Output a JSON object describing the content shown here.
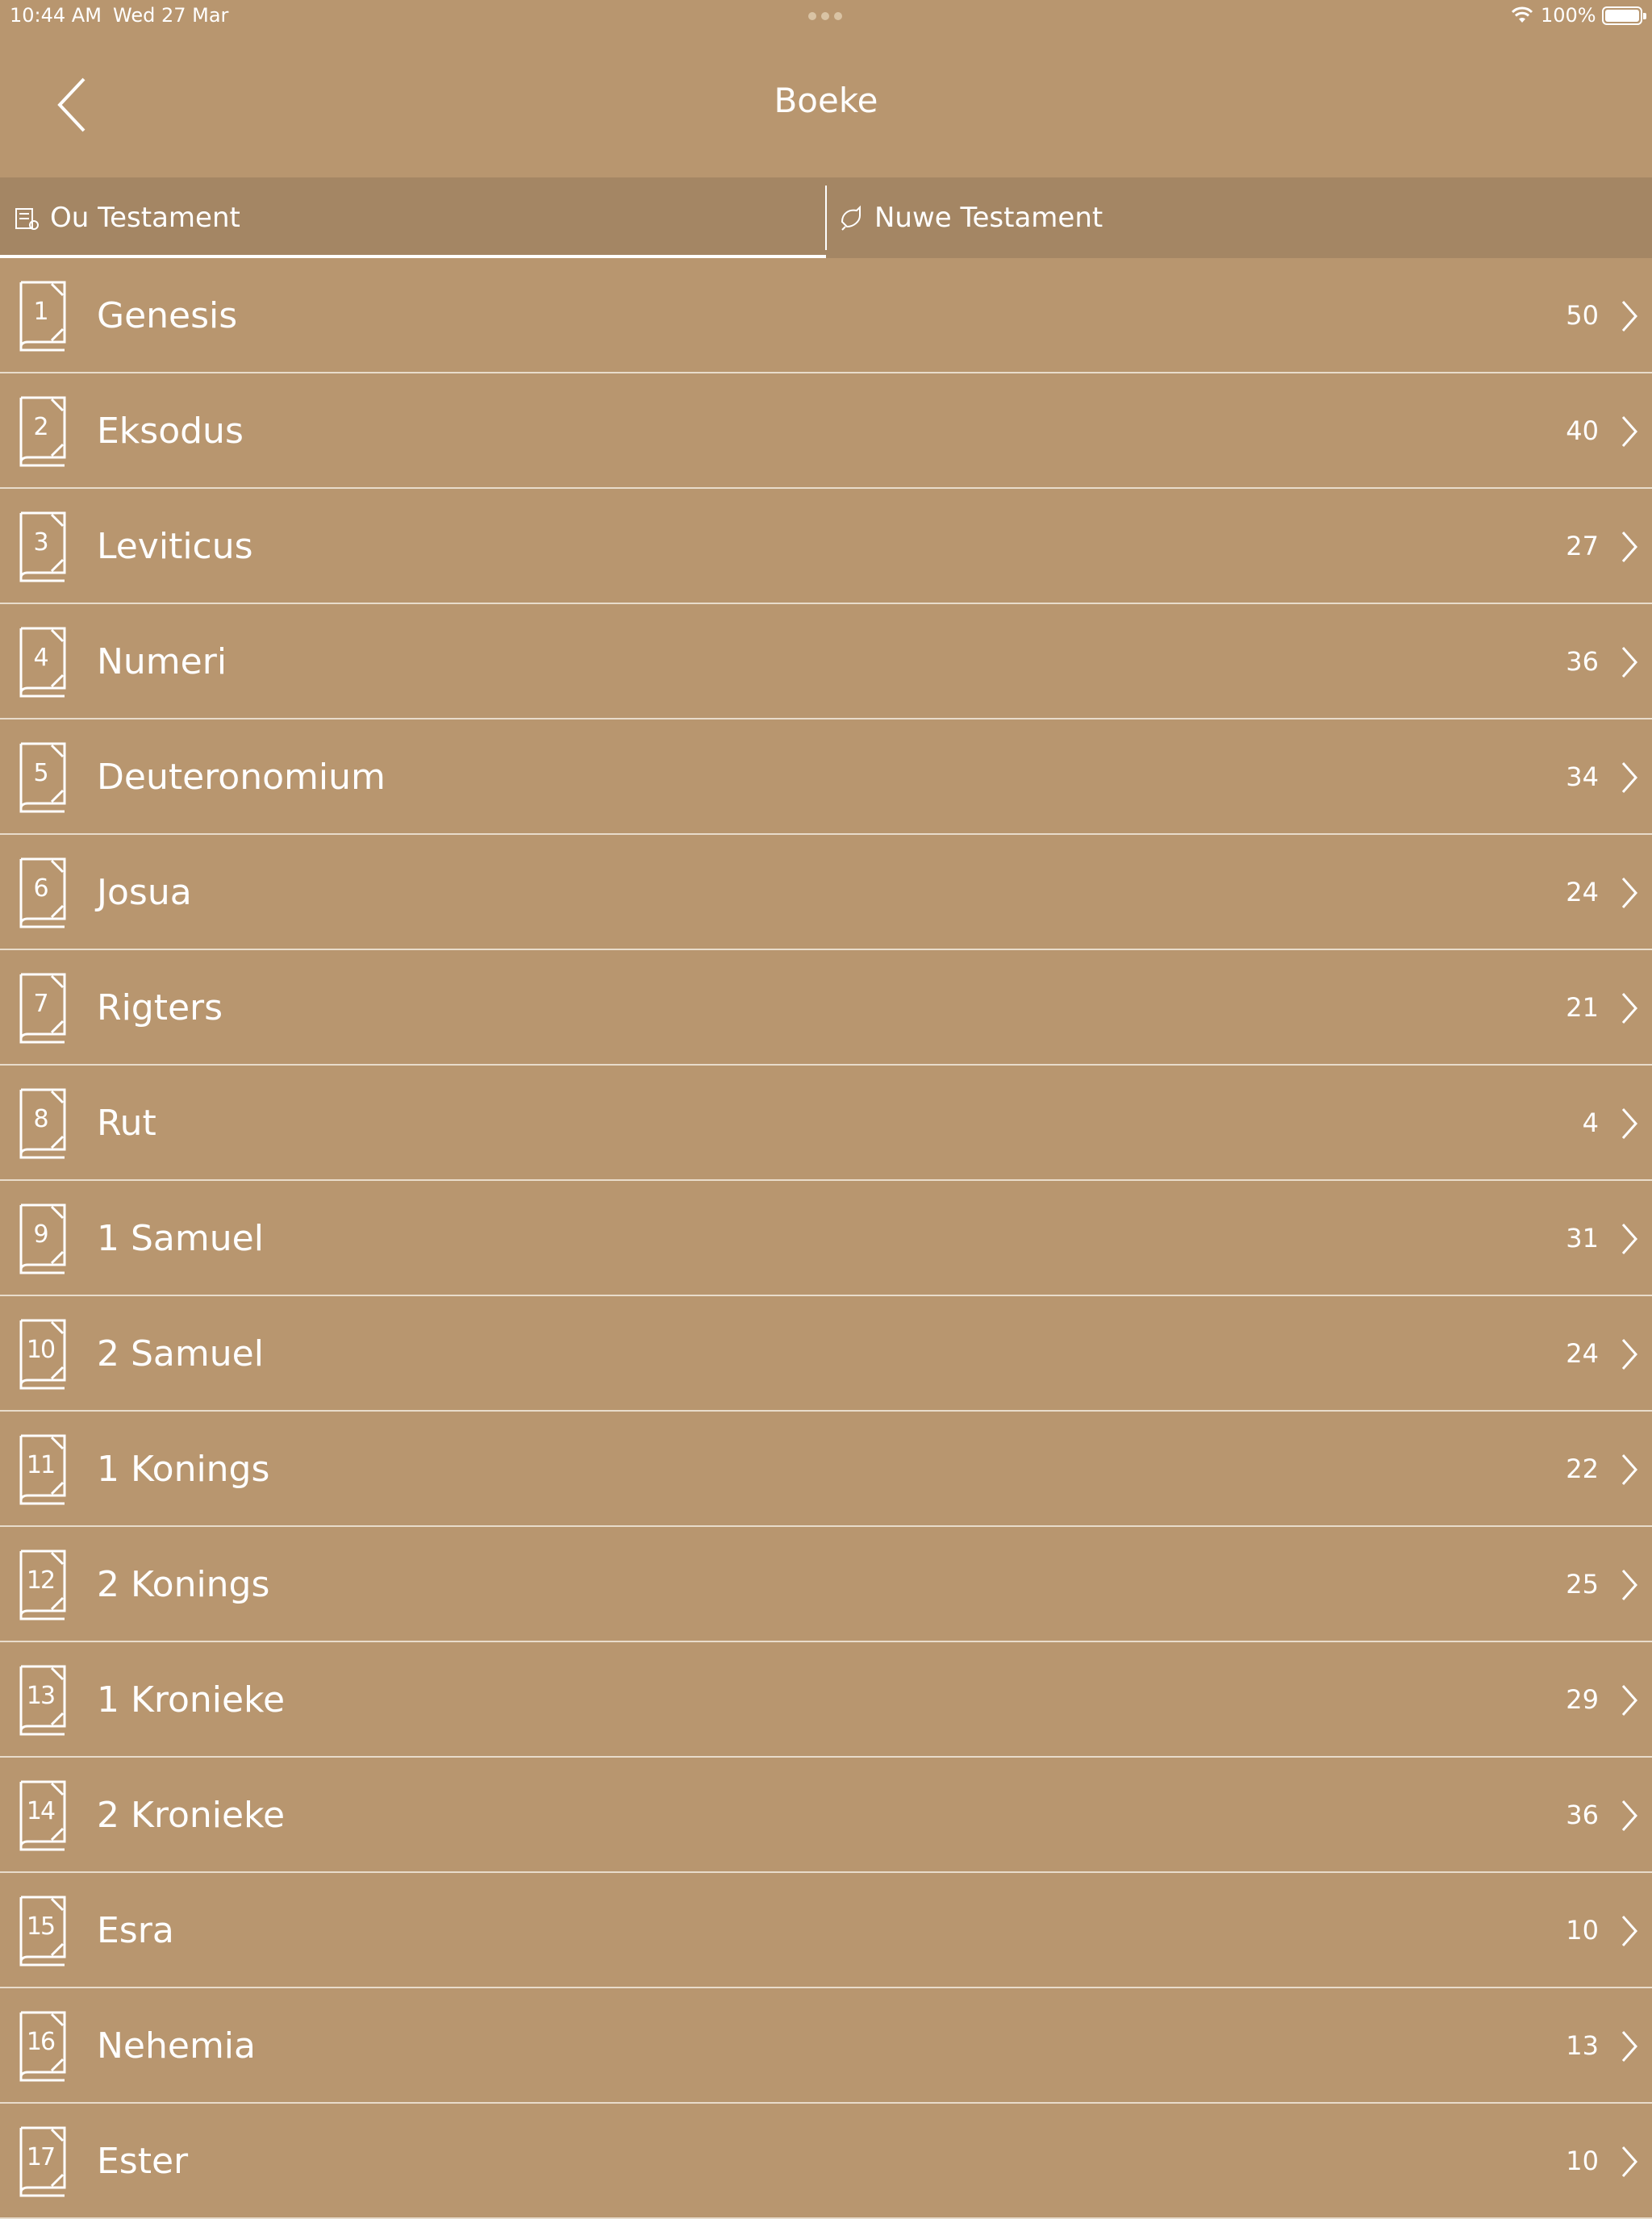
{
  "status": {
    "time": "10:44 AM",
    "date": "Wed 27 Mar",
    "battery": "100%"
  },
  "nav": {
    "title": "Boeke"
  },
  "tabs": {
    "old": "Ou Testament",
    "new": "Nuwe Testament"
  },
  "books": [
    {
      "num": "1",
      "name": "Genesis",
      "chapters": "50"
    },
    {
      "num": "2",
      "name": "Eksodus",
      "chapters": "40"
    },
    {
      "num": "3",
      "name": "Leviticus",
      "chapters": "27"
    },
    {
      "num": "4",
      "name": "Numeri",
      "chapters": "36"
    },
    {
      "num": "5",
      "name": "Deuteronomium",
      "chapters": "34"
    },
    {
      "num": "6",
      "name": "Josua",
      "chapters": "24"
    },
    {
      "num": "7",
      "name": "Rigters",
      "chapters": "21"
    },
    {
      "num": "8",
      "name": "Rut",
      "chapters": "4"
    },
    {
      "num": "9",
      "name": "1 Samuel",
      "chapters": "31"
    },
    {
      "num": "10",
      "name": "2 Samuel",
      "chapters": "24"
    },
    {
      "num": "11",
      "name": "1 Konings",
      "chapters": "22"
    },
    {
      "num": "12",
      "name": "2 Konings",
      "chapters": "25"
    },
    {
      "num": "13",
      "name": "1 Kronieke",
      "chapters": "29"
    },
    {
      "num": "14",
      "name": "2 Kronieke",
      "chapters": "36"
    },
    {
      "num": "15",
      "name": "Esra",
      "chapters": "10"
    },
    {
      "num": "16",
      "name": "Nehemia",
      "chapters": "13"
    },
    {
      "num": "17",
      "name": "Ester",
      "chapters": "10"
    }
  ]
}
